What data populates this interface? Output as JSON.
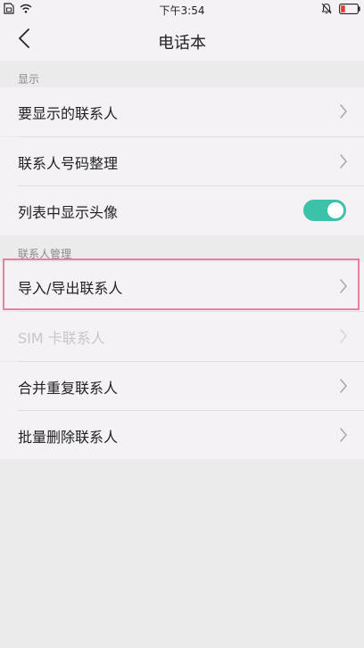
{
  "status_bar": {
    "time": "下午3:54",
    "left_icons": [
      "sim-icon",
      "wifi-icon"
    ],
    "right_icons": [
      "mute-icon",
      "battery-low-icon"
    ]
  },
  "header": {
    "title": "电话本",
    "back_icon": "chevron-left-icon"
  },
  "sections": [
    {
      "title": "显示",
      "items": [
        {
          "label": "要显示的联系人",
          "control": "chevron"
        },
        {
          "label": "联系人号码整理",
          "control": "chevron"
        },
        {
          "label": "列表中显示头像",
          "control": "toggle",
          "toggle_on": true
        }
      ]
    },
    {
      "title": "联系人管理",
      "items": [
        {
          "label": "导入/导出联系人",
          "control": "chevron",
          "highlighted": true
        },
        {
          "label": "SIM 卡联系人",
          "control": "chevron",
          "disabled": true
        },
        {
          "label": "合并重复联系人",
          "control": "chevron"
        },
        {
          "label": "批量删除联系人",
          "control": "chevron"
        }
      ]
    }
  ],
  "colors": {
    "toggle_on": "#3cc2a9",
    "highlight_border": "#e4819f",
    "disabled_text": "#c7c7c7",
    "battery_low": "#e53935"
  }
}
